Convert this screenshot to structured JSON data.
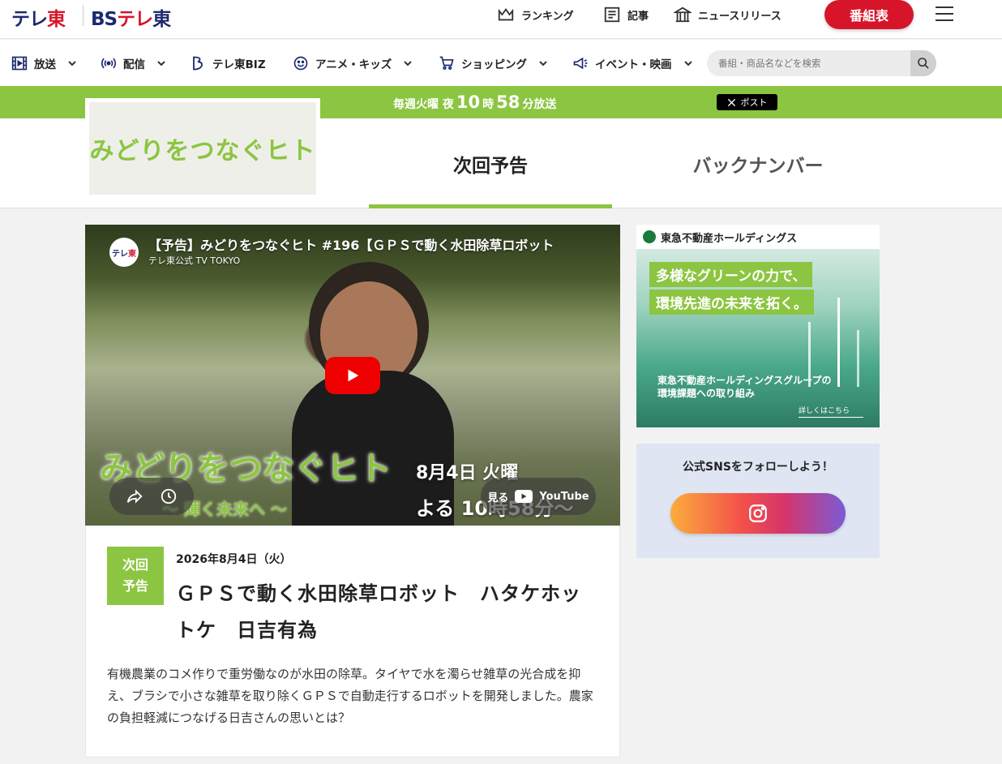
{
  "header": {
    "logo_teletoh": [
      "テレ",
      "東"
    ],
    "logo_bs": [
      "BS",
      "テレ",
      "東"
    ],
    "nav": [
      {
        "label": "ランキング",
        "icon": "crown-icon"
      },
      {
        "label": "記事",
        "icon": "article-icon"
      },
      {
        "label": "ニュースリリース",
        "icon": "building-icon"
      }
    ],
    "program_button": "番組表"
  },
  "subnav": {
    "items": [
      {
        "label": "放送",
        "icon": "tv-icon"
      },
      {
        "label": "配信",
        "icon": "broadcast-icon"
      },
      {
        "label": "テレ東BIZ",
        "icon": "biz-icon"
      },
      {
        "label": "アニメ・キッズ",
        "icon": "smile-icon"
      },
      {
        "label": "ショッピング",
        "icon": "cart-icon"
      },
      {
        "label": "イベント・映画",
        "icon": "megaphone-icon"
      }
    ],
    "search_placeholder": "番組・商品名などを検索"
  },
  "band": {
    "prefix": "毎週火曜 夜",
    "hour": "10",
    "hour_unit": "時",
    "minute": "58",
    "suffix": "分放送",
    "x_post": "ポスト"
  },
  "program": {
    "logo_text": "みどりをつなぐヒト",
    "tabs": [
      "次回予告",
      "バックナンバー"
    ]
  },
  "video": {
    "title": "【予告】みどりをつなぐヒト #196【ＧＰＳで動く水田除草ロボット",
    "channel": "テレ東公式 TV TOKYO",
    "channel_icon": [
      "テレ",
      "東"
    ],
    "brand": "みどりをつなぐヒト",
    "subtitle": "〜 輝く未来へ 〜",
    "date": "8月4日 火曜",
    "time": "よる 10時58分〜",
    "watch_on": "見る",
    "youtube": "YouTube"
  },
  "episode": {
    "badge": [
      "次回",
      "予告"
    ],
    "date": "2026年8月4日（火）",
    "title": "ＧＰＳで動く水田除草ロボット　ハタケホットケ　日吉有為",
    "description": "有機農業のコメ作りで重労働なのが水田の除草。タイヤで水を濁らせ雑草の光合成を抑え、ブラシで小さな雑草を取り除くＧＰＳで自動走行するロボットを開発しました。農家の負担軽減につなげる日吉さんの思いとは？"
  },
  "ad": {
    "company": "東急不動産ホールディングス",
    "copy1": "多様なグリーンの力で、",
    "copy2": "環境先進の未来を拓く。",
    "bottom1": "東急不動産ホールディングスグループの",
    "bottom2": "環境課題への取り組み",
    "more": "詳しくはこちら"
  },
  "sns": {
    "title": "公式SNSをフォローしよう！",
    "instagram_icon": "instagram-icon"
  }
}
